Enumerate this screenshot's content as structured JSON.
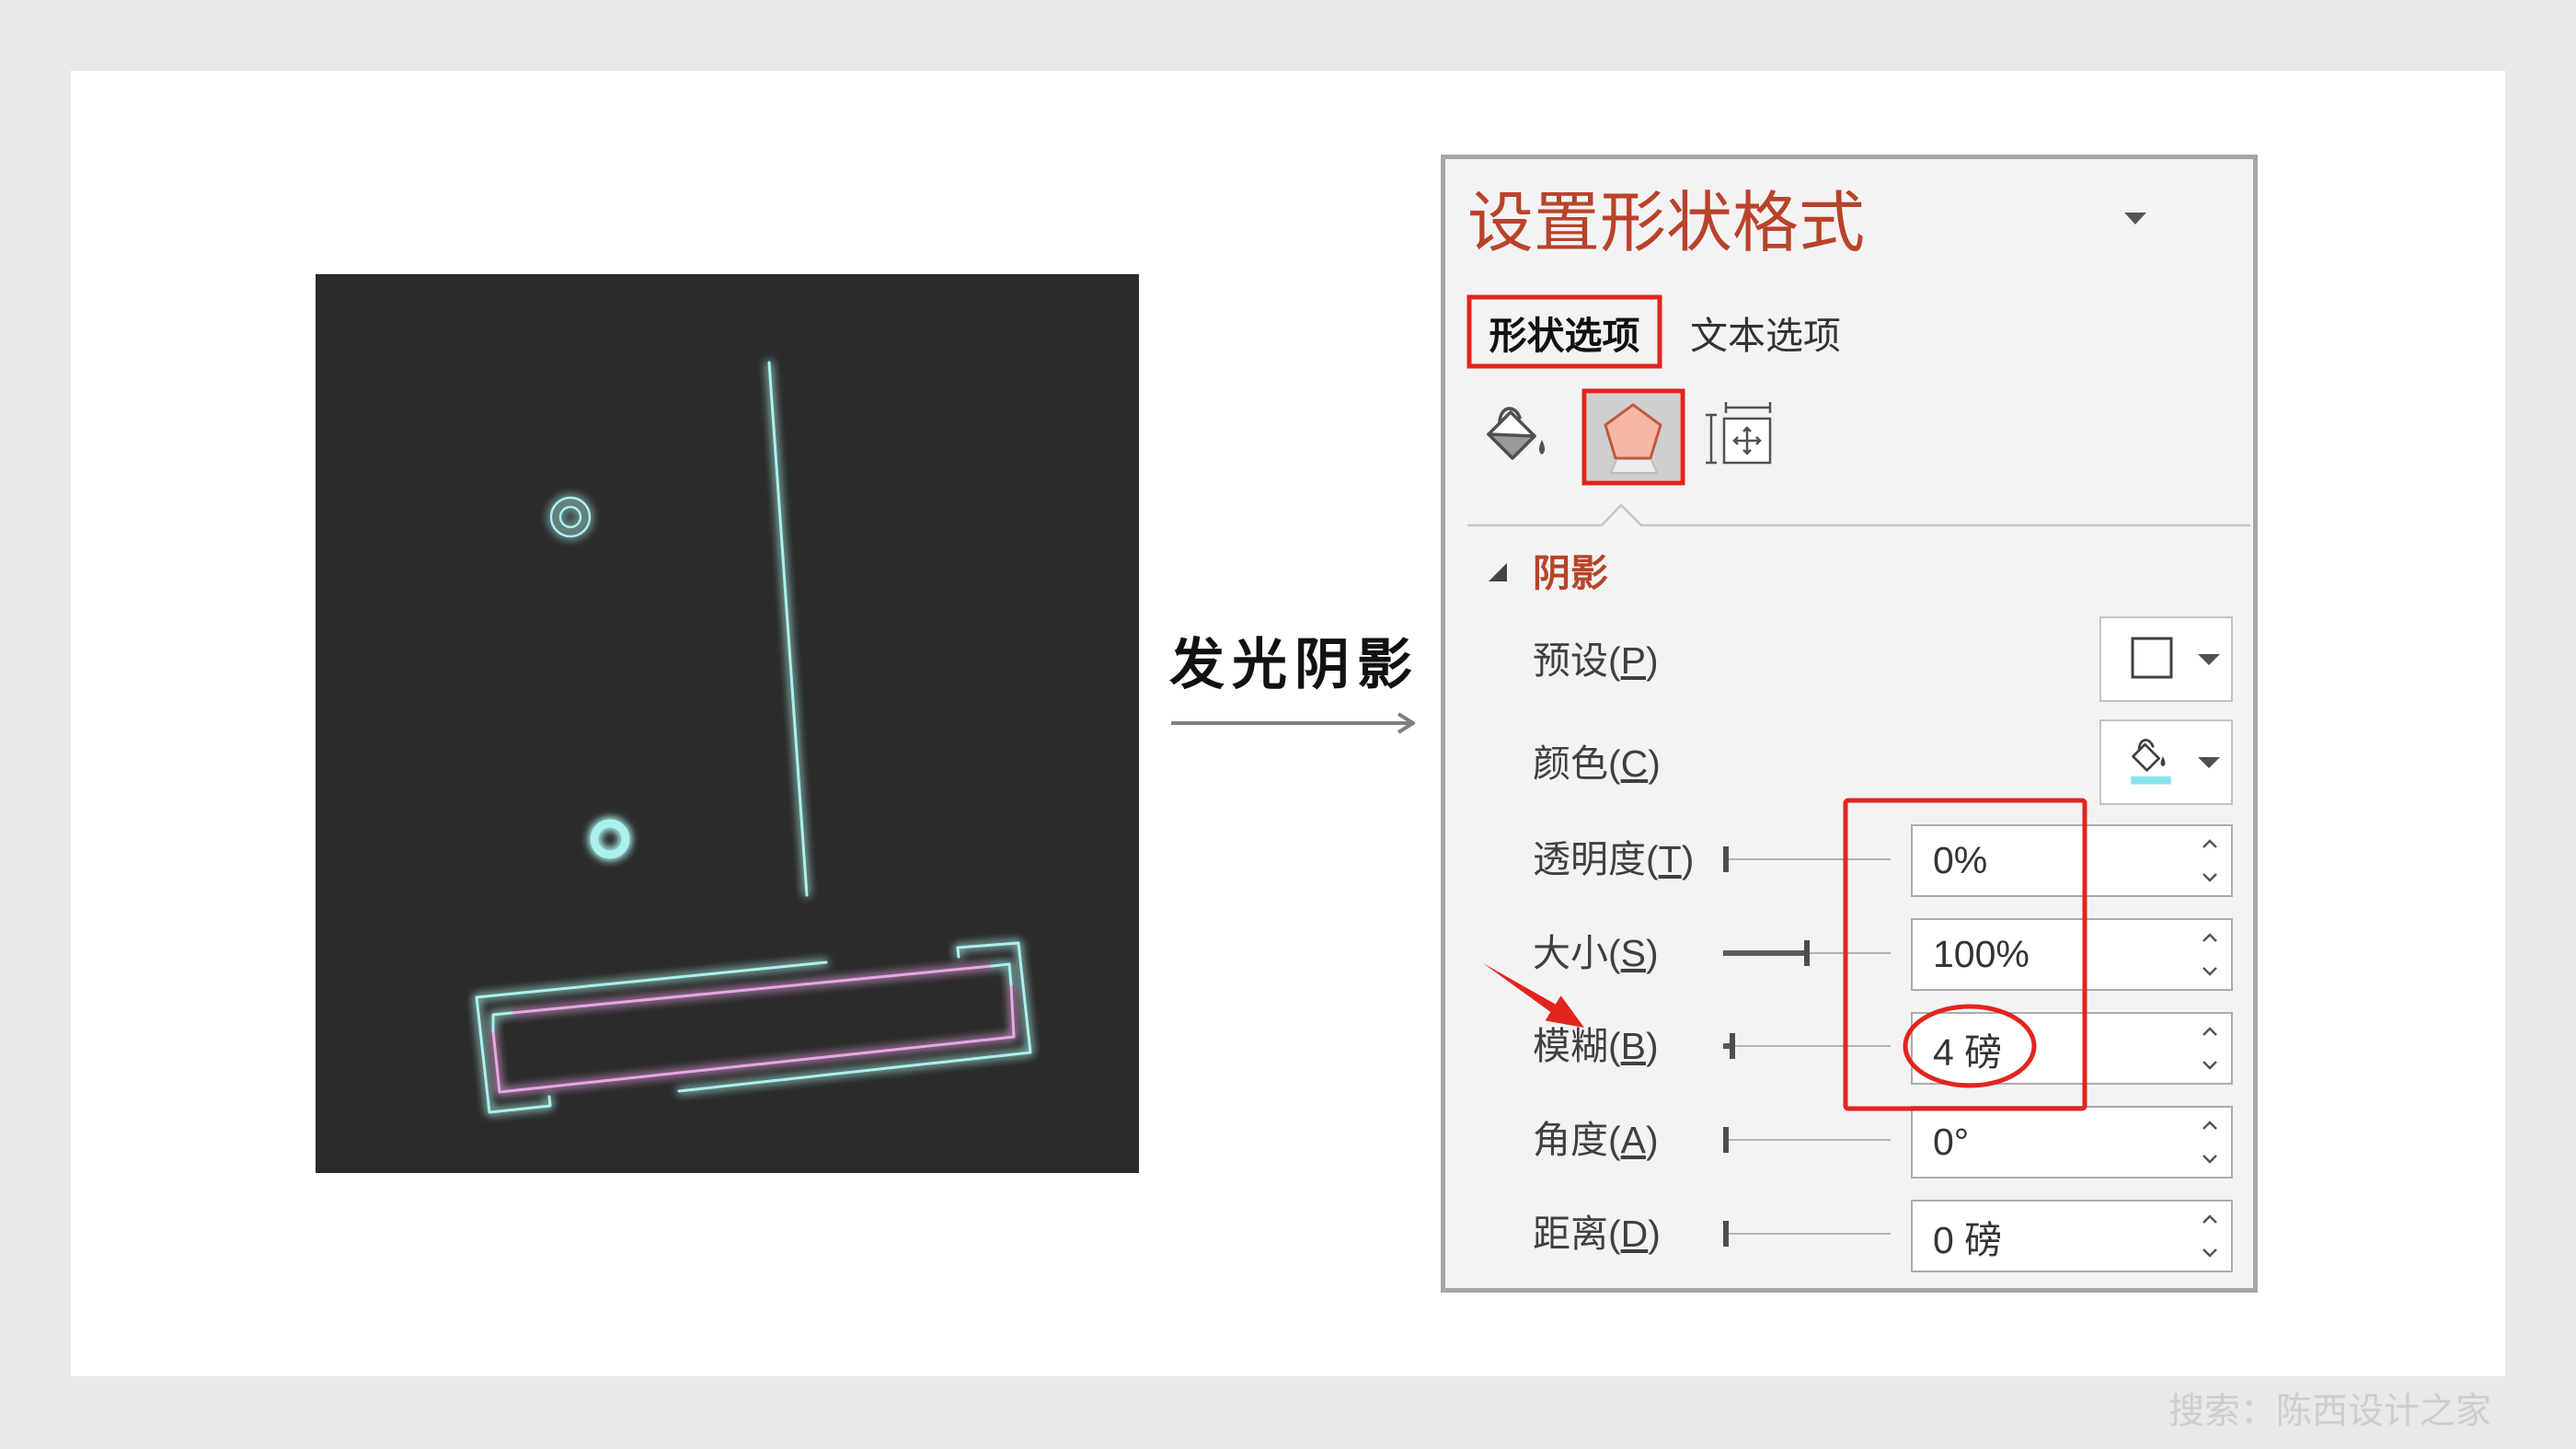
{
  "slide": {
    "caption": "发光阴影",
    "watermark": "搜索：陈西设计之家"
  },
  "pane": {
    "title": "设置形状格式",
    "tabs": [
      {
        "label": "形状选项",
        "selected": true
      },
      {
        "label": "文本选项",
        "selected": false
      }
    ],
    "icon_tabs": [
      {
        "icon": "fill-line-icon",
        "selected": false
      },
      {
        "icon": "effects-pentagon-icon",
        "selected": true
      },
      {
        "icon": "size-properties-icon",
        "selected": false
      }
    ],
    "section": {
      "title": "阴影",
      "expanded": true
    },
    "rows": [
      {
        "label_before": "预设(",
        "key": "P",
        "label_after": ")",
        "icon": "no-shadow-square-icon"
      },
      {
        "label_before": "颜色(",
        "key": "C",
        "label_after": ")",
        "icon": "paint-bucket-icon"
      },
      {
        "label_before": "透明度(",
        "key": "T",
        "label_after": ")",
        "value": "0%",
        "slider_level": 0
      },
      {
        "label_before": "大小(",
        "key": "S",
        "label_after": ")",
        "value": "100%",
        "slider_level": 0.5
      },
      {
        "label_before": "模糊(",
        "key": "B",
        "label_after": ")",
        "value": "4 磅",
        "slider_level": 0.04
      },
      {
        "label_before": "角度(",
        "key": "A",
        "label_after": ")",
        "value": "0°",
        "slider_level": 0
      },
      {
        "label_before": "距离(",
        "key": "D",
        "label_after": ")",
        "value": "0 磅",
        "slider_level": 0
      }
    ]
  },
  "colors": {
    "page_background": "#e8e7e9",
    "slide_background": "#ffffff",
    "artwork_background": "#2b2b2b",
    "glow_cyan": "#aaf0ec",
    "glow_pink": "#e8a6e4",
    "pane_background": "#f3f3f3",
    "pane_border": "#a6a6a6",
    "accent": "#b8432a",
    "annotation_red": "#e3241e",
    "shadow_color": "#86e5ea",
    "selected_icon_fill": "#f6b8a5"
  }
}
